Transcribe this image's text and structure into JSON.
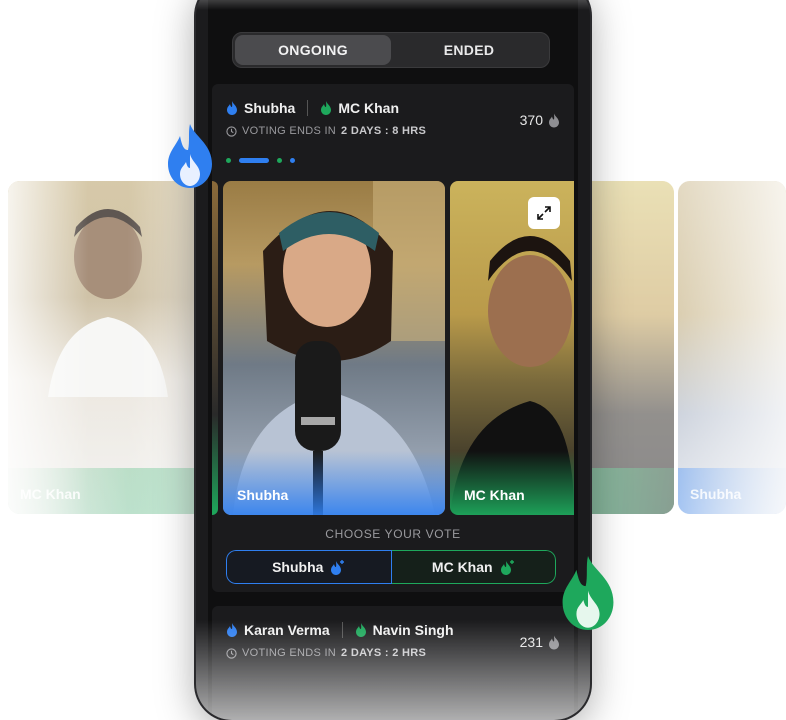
{
  "tabs": {
    "ongoing": "ONGOING",
    "ended": "ENDED"
  },
  "battle1": {
    "contestant_a": "Shubha",
    "contestant_b": "MC Khan",
    "voting_prefix": "VOTING ENDS IN",
    "voting_time": "2 DAYS : 8 HRS",
    "count": "370",
    "video_a_label": "Shubha",
    "video_b_label": "MC Khan",
    "choose_label": "CHOOSE YOUR VOTE",
    "vote_a": "Shubha",
    "vote_b": "MC Khan"
  },
  "battle2": {
    "contestant_a": "Karan Verma",
    "contestant_b": "Navin Singh",
    "voting_prefix": "VOTING ENDS IN",
    "voting_time": "2 DAYS : 2 HRS",
    "count": "231"
  },
  "background_cards": {
    "left_label": "MC Khan",
    "right_label": "Shubha"
  },
  "colors": {
    "blue": "#2f7ff0",
    "green": "#1ea85c",
    "bg_dark": "#0f0f10",
    "card": "#1b1b1d"
  },
  "icons": [
    "flame-icon",
    "clock-icon",
    "expand-icon",
    "flame-plus-icon"
  ]
}
